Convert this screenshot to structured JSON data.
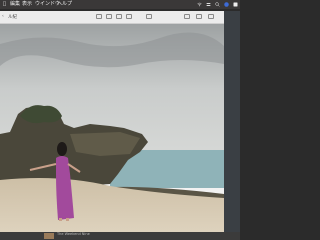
{
  "menubar": {
    "apple_icon": "apple-logo-icon",
    "items": [
      "編集",
      "表示",
      "ウインドウ",
      "ヘルプ"
    ]
  },
  "toolbar": {
    "back_glyph": "‹",
    "title": "ル紀"
  },
  "status_icons": [
    "wifi-icon",
    "control-center-icon",
    "search-icon",
    "user-icon",
    "clock-icon"
  ],
  "bottombar": {
    "text": "The Weekend Nine"
  },
  "colors": {
    "sky": "#c8cccb",
    "sea": "#8fb3b8",
    "sand": "#d9cdb6",
    "dress": "#a24a9c",
    "rock": "#4e4a3d"
  }
}
